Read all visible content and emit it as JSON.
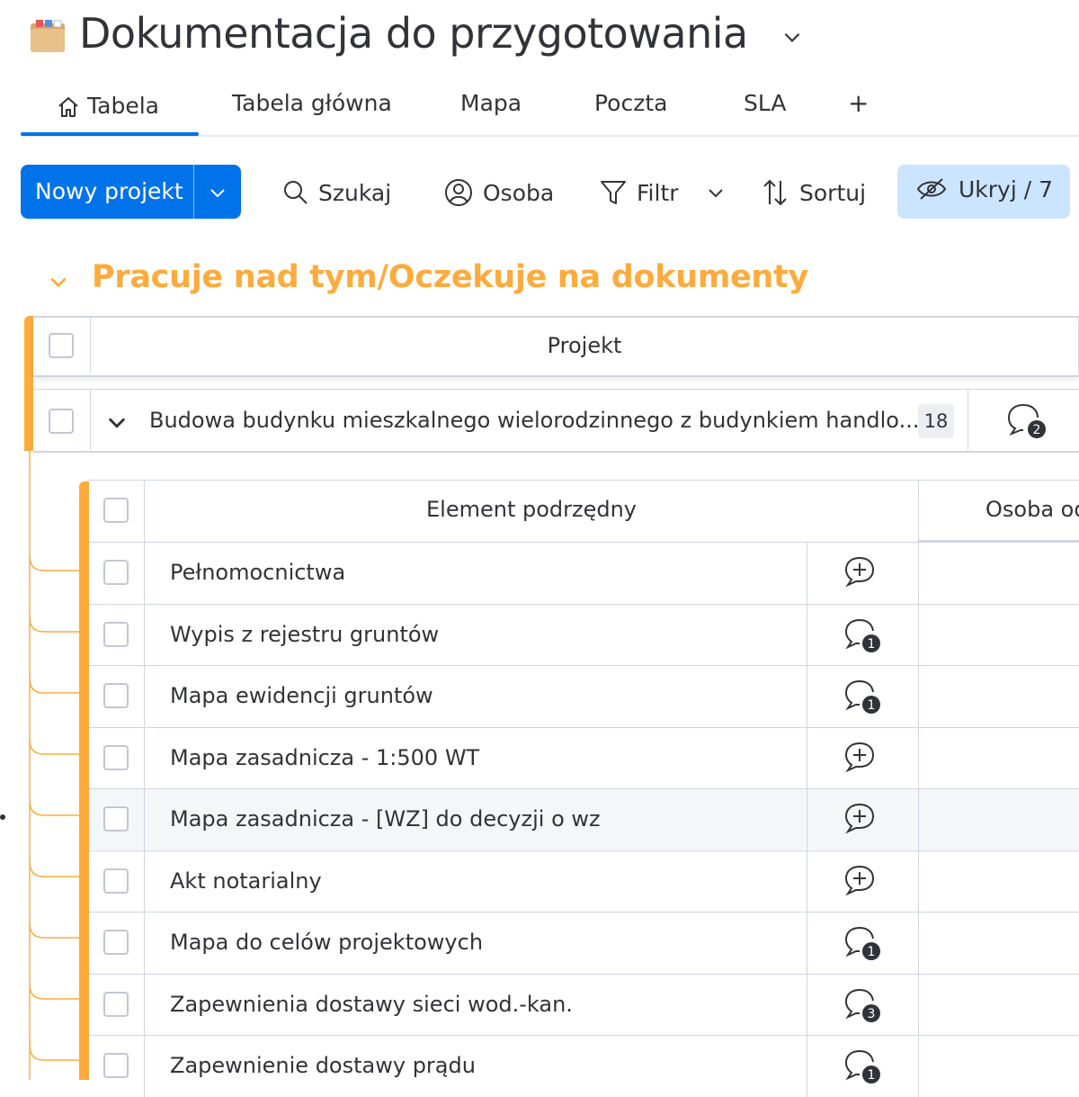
{
  "header": {
    "title": "Dokumentacja do przygotowania"
  },
  "tabs": [
    "Tabela",
    "Tabela główna",
    "Mapa",
    "Poczta",
    "SLA"
  ],
  "tab_add": "+",
  "toolbar": {
    "new_project": "Nowy projekt",
    "search": "Szukaj",
    "person": "Osoba",
    "filter": "Filtr",
    "sort": "Sortuj",
    "hide": "Ukryj / 7"
  },
  "group": {
    "title": "Pracuje nad tym/Oczekuje na dokumenty",
    "color": "#fdab3d"
  },
  "main_table": {
    "header": "Projekt",
    "row": {
      "name": "Budowa budynku mieszkalnego wielorodzinnego z budynkiem handlo...",
      "subitem_count": "18",
      "update_count": "2"
    }
  },
  "subitems": {
    "header": "Element podrzędny",
    "person_header": "Osoba od",
    "rows": [
      {
        "name": "Pełnomocnictwa",
        "updates": ""
      },
      {
        "name": "Wypis z rejestru gruntów",
        "updates": "1"
      },
      {
        "name": "Mapa ewidencji gruntów",
        "updates": "1"
      },
      {
        "name": "Mapa zasadnicza - 1:500 WT",
        "updates": ""
      },
      {
        "name": "Mapa zasadnicza - [WZ] do decyzji o wz",
        "updates": ""
      },
      {
        "name": "Akt notarialny",
        "updates": ""
      },
      {
        "name": "Mapa do celów projektowych",
        "updates": "1"
      },
      {
        "name": "Zapewnienia dostawy sieci wod.-kan.",
        "updates": "3"
      },
      {
        "name": "Zapewnienie dostawy prądu",
        "updates": "1"
      }
    ]
  },
  "colors": {
    "accent": "#0073ea",
    "group": "#fdab3d",
    "hide_bg": "#cce5ff"
  }
}
